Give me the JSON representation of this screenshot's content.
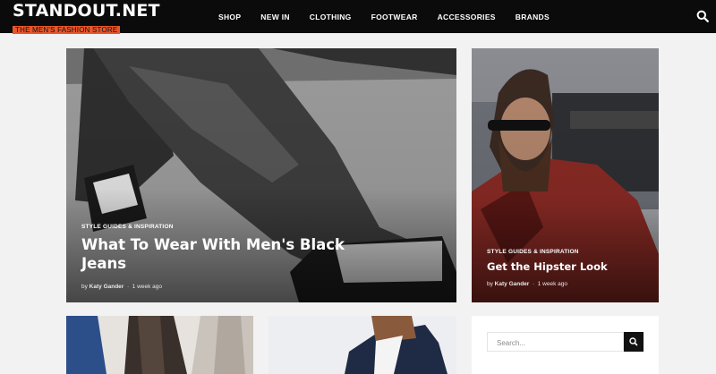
{
  "header": {
    "logo_title": "STANDOUT.NET",
    "logo_tagline": "THE MEN'S FASHION STORE",
    "nav": [
      "SHOP",
      "NEW IN",
      "CLOTHING",
      "FOOTWEAR",
      "ACCESSORIES",
      "BRANDS"
    ],
    "search_icon": "search-icon"
  },
  "featured": {
    "category": "STYLE GUIDES & INSPIRATION",
    "title": "What To Wear With Men's Black Jeans",
    "author": "Katy Gander",
    "date": "1 week ago"
  },
  "side_post": {
    "category": "STYLE GUIDES & INSPIRATION",
    "title": "Get the Hipster Look",
    "author": "Katy Gander",
    "date": "1 week ago"
  },
  "sidebar": {
    "search_placeholder": "Search...",
    "search_icon": "search-icon"
  },
  "colors": {
    "header_bg": "#0b0b0b",
    "accent": "#e8562b",
    "page_bg": "#f2f2f2"
  }
}
